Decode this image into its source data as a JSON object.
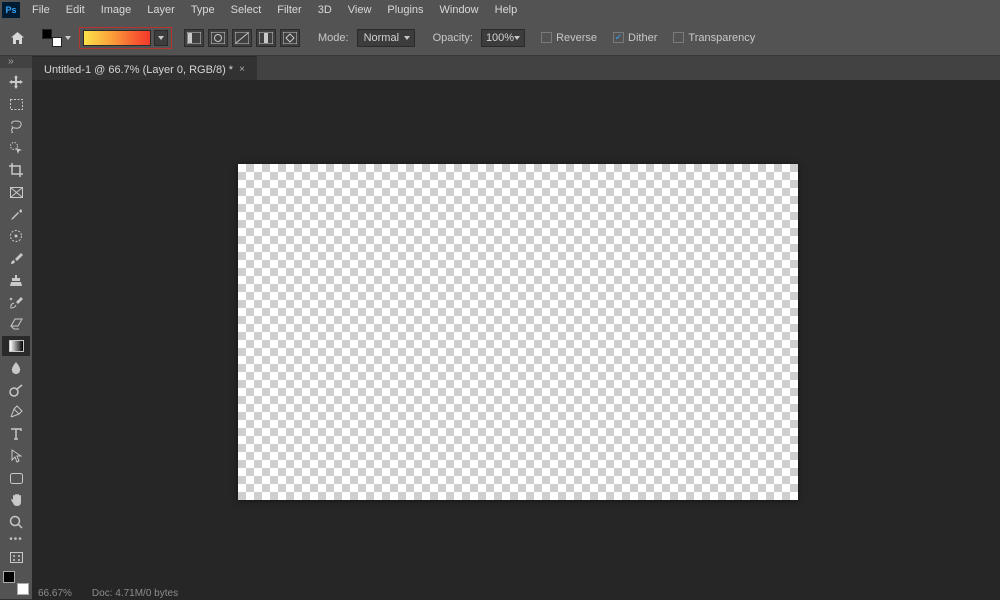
{
  "app": {
    "icon_text": "Ps"
  },
  "menu": [
    "File",
    "Edit",
    "Image",
    "Layer",
    "Type",
    "Select",
    "Filter",
    "3D",
    "View",
    "Plugins",
    "Window",
    "Help"
  ],
  "options": {
    "mode_label": "Mode:",
    "mode_value": "Normal",
    "opacity_label": "Opacity:",
    "opacity_value": "100%",
    "reverse": {
      "label": "Reverse",
      "checked": false
    },
    "dither": {
      "label": "Dither",
      "checked": true
    },
    "transparency": {
      "label": "Transparency",
      "checked": false
    }
  },
  "document": {
    "tab_title": "Untitled-1 @ 66.7% (Layer 0, RGB/8) *"
  },
  "tools": [
    "move-tool",
    "marquee-tool",
    "lasso-tool",
    "quick-select-tool",
    "crop-tool",
    "frame-tool",
    "eyedropper-tool",
    "spot-heal-tool",
    "brush-tool",
    "clone-stamp-tool",
    "history-brush-tool",
    "eraser-tool",
    "gradient-tool",
    "blur-tool",
    "dodge-tool",
    "pen-tool",
    "type-tool",
    "path-select-tool",
    "rectangle-tool",
    "hand-tool",
    "zoom-tool"
  ],
  "status": {
    "zoom": "66.67%",
    "doc_info": "Doc: 4.71M/0 bytes"
  },
  "colors": {
    "stroke_icon": "#c8c8c8"
  }
}
